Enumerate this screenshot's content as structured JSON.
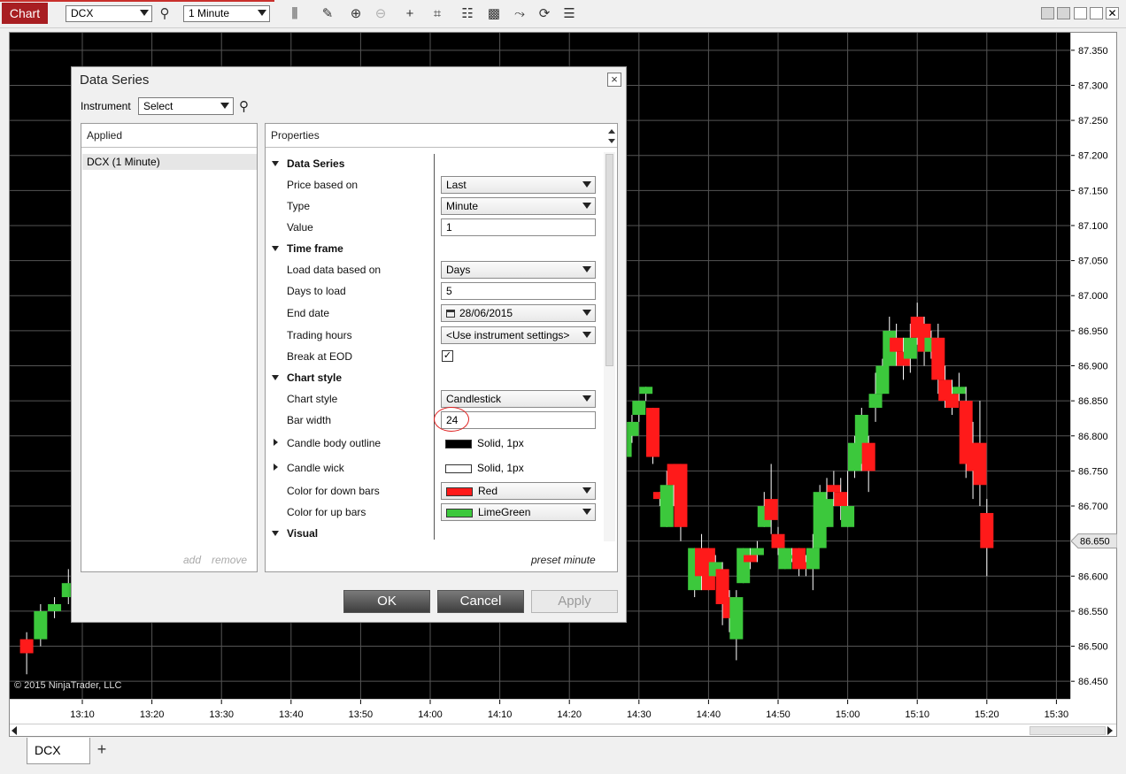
{
  "toolbar": {
    "chart_tab": "Chart",
    "instrument": "DCX",
    "interval": "1 Minute",
    "icons": [
      "search-icon",
      "bar-type-icon",
      "pencil-icon",
      "zoom-in-icon",
      "zoom-out-icon",
      "crosshair-icon",
      "data-box-icon",
      "chart-trader-icon",
      "global-link-icon",
      "strategies-icon",
      "reload-icon",
      "properties-icon"
    ]
  },
  "chart": {
    "copyright": "© 2015 NinjaTrader, LLC",
    "price_labels": [
      "87.350",
      "87.300",
      "87.250",
      "87.200",
      "87.150",
      "87.100",
      "87.050",
      "87.000",
      "86.950",
      "86.900",
      "86.850",
      "86.800",
      "86.750",
      "86.700",
      "86.650",
      "86.600",
      "86.550",
      "86.500",
      "86.450"
    ],
    "current_price": "86.650",
    "time_labels": [
      "13:10",
      "13:20",
      "13:30",
      "13:40",
      "13:50",
      "14:00",
      "14:10",
      "14:20",
      "14:30",
      "14:40",
      "14:50",
      "15:00",
      "15:10",
      "15:20",
      "15:30"
    ],
    "colors": {
      "up": "#3cc83c",
      "down": "#ff1a1a",
      "wick": "#ffffff",
      "background": "#000000",
      "grid": "#555555"
    }
  },
  "chart_data": {
    "type": "candlestick",
    "interval": "1 Minute",
    "ylim": [
      86.425,
      87.375
    ],
    "candles": [
      {
        "t": "13:02",
        "o": 86.51,
        "c": 86.49,
        "h": 86.52,
        "l": 86.46
      },
      {
        "t": "13:04",
        "o": 86.51,
        "c": 86.55,
        "h": 86.56,
        "l": 86.5
      },
      {
        "t": "13:06",
        "o": 86.55,
        "c": 86.56,
        "h": 86.57,
        "l": 86.54
      },
      {
        "t": "13:08",
        "o": 86.57,
        "c": 86.59,
        "h": 86.61,
        "l": 86.56
      },
      {
        "t": "14:28",
        "o": 86.77,
        "c": 86.81,
        "h": 86.82,
        "l": 86.76
      },
      {
        "t": "14:29",
        "o": 86.8,
        "c": 86.82,
        "h": 86.83,
        "l": 86.79
      },
      {
        "t": "14:30",
        "o": 86.83,
        "c": 86.85,
        "h": 86.85,
        "l": 86.82
      },
      {
        "t": "14:31",
        "o": 86.86,
        "c": 86.87,
        "h": 86.87,
        "l": 86.85
      },
      {
        "t": "14:32",
        "o": 86.84,
        "c": 86.77,
        "h": 86.84,
        "l": 86.76
      },
      {
        "t": "14:33",
        "o": 86.72,
        "c": 86.71,
        "h": 86.72,
        "l": 86.7
      },
      {
        "t": "14:34",
        "o": 86.67,
        "c": 86.73,
        "h": 86.75,
        "l": 86.67
      },
      {
        "t": "14:35",
        "o": 86.76,
        "c": 86.73,
        "h": 86.76,
        "l": 86.7
      },
      {
        "t": "14:36",
        "o": 86.76,
        "c": 86.67,
        "h": 86.76,
        "l": 86.65
      },
      {
        "t": "14:38",
        "o": 86.58,
        "c": 86.64,
        "h": 86.64,
        "l": 86.57
      },
      {
        "t": "14:39",
        "o": 86.64,
        "c": 86.6,
        "h": 86.66,
        "l": 86.58
      },
      {
        "t": "14:40",
        "o": 86.64,
        "c": 86.58,
        "h": 86.64,
        "l": 86.58
      },
      {
        "t": "14:41",
        "o": 86.6,
        "c": 86.62,
        "h": 86.63,
        "l": 86.6
      },
      {
        "t": "14:42",
        "o": 86.61,
        "c": 86.56,
        "h": 86.62,
        "l": 86.53
      },
      {
        "t": "14:43",
        "o": 86.57,
        "c": 86.54,
        "h": 86.58,
        "l": 86.52
      },
      {
        "t": "14:44",
        "o": 86.51,
        "c": 86.57,
        "h": 86.58,
        "l": 86.48
      },
      {
        "t": "14:45",
        "o": 86.59,
        "c": 86.64,
        "h": 86.64,
        "l": 86.59
      },
      {
        "t": "14:46",
        "o": 86.63,
        "c": 86.62,
        "h": 86.64,
        "l": 86.61
      },
      {
        "t": "14:47",
        "o": 86.63,
        "c": 86.64,
        "h": 86.65,
        "l": 86.62
      },
      {
        "t": "14:48",
        "o": 86.67,
        "c": 86.7,
        "h": 86.72,
        "l": 86.67
      },
      {
        "t": "14:49",
        "o": 86.71,
        "c": 86.68,
        "h": 86.76,
        "l": 86.66
      },
      {
        "t": "14:50",
        "o": 86.66,
        "c": 86.64,
        "h": 86.67,
        "l": 86.63
      },
      {
        "t": "14:51",
        "o": 86.61,
        "c": 86.64,
        "h": 86.64,
        "l": 86.61
      },
      {
        "t": "14:52",
        "o": 86.63,
        "c": 86.63,
        "h": 86.64,
        "l": 86.62
      },
      {
        "t": "14:53",
        "o": 86.64,
        "c": 86.61,
        "h": 86.64,
        "l": 86.6
      },
      {
        "t": "14:54",
        "o": 86.62,
        "c": 86.61,
        "h": 86.63,
        "l": 86.6
      },
      {
        "t": "14:55",
        "o": 86.61,
        "c": 86.64,
        "h": 86.66,
        "l": 86.58
      },
      {
        "t": "14:56",
        "o": 86.64,
        "c": 86.72,
        "h": 86.73,
        "l": 86.64
      },
      {
        "t": "14:57",
        "o": 86.67,
        "c": 86.71,
        "h": 86.74,
        "l": 86.67
      },
      {
        "t": "14:58",
        "o": 86.73,
        "c": 86.72,
        "h": 86.75,
        "l": 86.7
      },
      {
        "t": "14:59",
        "o": 86.72,
        "c": 86.7,
        "h": 86.74,
        "l": 86.68
      },
      {
        "t": "15:00",
        "o": 86.67,
        "c": 86.7,
        "h": 86.75,
        "l": 86.67
      },
      {
        "t": "15:01",
        "o": 86.75,
        "c": 86.79,
        "h": 86.8,
        "l": 86.74
      },
      {
        "t": "15:02",
        "o": 86.76,
        "c": 86.83,
        "h": 86.84,
        "l": 86.75
      },
      {
        "t": "15:03",
        "o": 86.79,
        "c": 86.75,
        "h": 86.8,
        "l": 86.72
      },
      {
        "t": "15:04",
        "o": 86.84,
        "c": 86.86,
        "h": 86.89,
        "l": 86.82
      },
      {
        "t": "15:05",
        "o": 86.86,
        "c": 86.9,
        "h": 86.91,
        "l": 86.86
      },
      {
        "t": "15:06",
        "o": 86.9,
        "c": 86.95,
        "h": 86.97,
        "l": 86.9
      },
      {
        "t": "15:07",
        "o": 86.94,
        "c": 86.92,
        "h": 86.96,
        "l": 86.9
      },
      {
        "t": "15:08",
        "o": 86.92,
        "c": 86.9,
        "h": 86.94,
        "l": 86.88
      },
      {
        "t": "15:09",
        "o": 86.91,
        "c": 86.94,
        "h": 86.96,
        "l": 86.89
      },
      {
        "t": "15:10",
        "o": 86.97,
        "c": 86.94,
        "h": 86.99,
        "l": 86.93
      },
      {
        "t": "15:11",
        "o": 86.96,
        "c": 86.92,
        "h": 86.97,
        "l": 86.9
      },
      {
        "t": "15:12",
        "o": 86.92,
        "c": 86.94,
        "h": 86.95,
        "l": 86.91
      },
      {
        "t": "15:13",
        "o": 86.94,
        "c": 86.88,
        "h": 86.96,
        "l": 86.86
      },
      {
        "t": "15:14",
        "o": 86.88,
        "c": 86.85,
        "h": 86.9,
        "l": 86.84
      },
      {
        "t": "15:15",
        "o": 86.86,
        "c": 86.84,
        "h": 86.88,
        "l": 86.83
      },
      {
        "t": "15:16",
        "o": 86.86,
        "c": 86.87,
        "h": 86.89,
        "l": 86.85
      },
      {
        "t": "15:17",
        "o": 86.85,
        "c": 86.76,
        "h": 86.87,
        "l": 86.74
      },
      {
        "t": "15:18",
        "o": 86.79,
        "c": 86.75,
        "h": 86.82,
        "l": 86.71
      },
      {
        "t": "15:19",
        "o": 86.79,
        "c": 86.73,
        "h": 86.85,
        "l": 86.7
      },
      {
        "t": "15:20",
        "o": 86.69,
        "c": 86.64,
        "h": 86.71,
        "l": 86.6
      }
    ]
  },
  "bottom_tabs": {
    "active": "DCX",
    "add": "+"
  },
  "dialog": {
    "title": "Data Series",
    "close": "×",
    "instrument_label": "Instrument",
    "instrument_select": "Select",
    "applied_header": "Applied",
    "applied_item": "DCX (1 Minute)",
    "add": "add",
    "remove": "remove",
    "properties_header": "Properties",
    "preset": "preset minute",
    "buttons": {
      "ok": "OK",
      "cancel": "Cancel",
      "apply": "Apply"
    },
    "rows": {
      "data_series": "Data Series",
      "price_based_on": {
        "label": "Price based on",
        "value": "Last"
      },
      "type": {
        "label": "Type",
        "value": "Minute"
      },
      "value": {
        "label": "Value",
        "value": "1"
      },
      "time_frame": "Time frame",
      "load_data": {
        "label": "Load data based on",
        "value": "Days"
      },
      "days_to_load": {
        "label": "Days to load",
        "value": "5"
      },
      "end_date": {
        "label": "End date",
        "value": "28/06/2015"
      },
      "trading_hours": {
        "label": "Trading hours",
        "value": "<Use instrument settings>"
      },
      "break_at_eod": {
        "label": "Break at EOD",
        "value": "✓"
      },
      "chart_style_cat": "Chart style",
      "chart_style": {
        "label": "Chart style",
        "value": "Candlestick"
      },
      "bar_width": {
        "label": "Bar width",
        "value": "24"
      },
      "candle_body_outline": {
        "label": "Candle body outline",
        "value": "Solid, 1px"
      },
      "candle_wick": {
        "label": "Candle wick",
        "value": "Solid, 1px"
      },
      "down_bars": {
        "label": "Color for down bars",
        "value": "Red"
      },
      "up_bars": {
        "label": "Color for up bars",
        "value": "LimeGreen"
      },
      "visual": "Visual"
    }
  }
}
